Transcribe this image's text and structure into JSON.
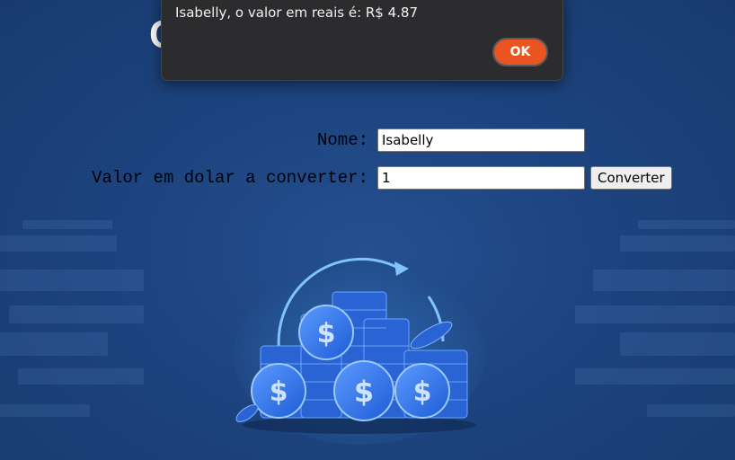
{
  "page": {
    "heading": "C"
  },
  "form": {
    "name_label": "Nome:",
    "name_value": "Isabelly",
    "amount_label": "Valor em dolar a converter:",
    "amount_value": "1",
    "convert_label": "Converter"
  },
  "alert": {
    "message": "Isabelly, o valor em reais é: R$ 4.87",
    "ok_label": "OK"
  },
  "illustration": {
    "coin_symbol": "$",
    "icon": "coin-stack-icon"
  },
  "colors": {
    "background": "#1d447f",
    "alert_background": "#2c2c2e",
    "ok_button": "#e95420",
    "coin": "#2f6ee0"
  }
}
